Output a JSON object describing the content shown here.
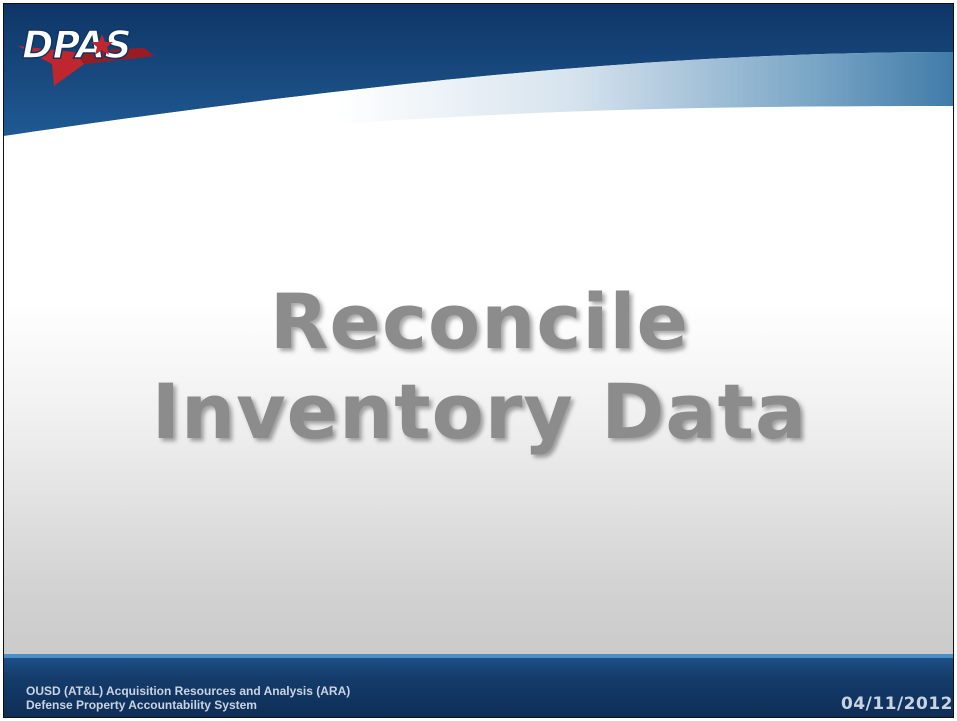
{
  "header": {
    "logo_text": "DPAS"
  },
  "slide": {
    "title_line1": "Reconcile",
    "title_line2": "Inventory Data"
  },
  "footer": {
    "org_line1": "OUSD (AT&L) Acquisition Resources and Analysis (ARA)",
    "org_line2": "Defense Property Accountability System",
    "date": "04/11/2012"
  },
  "colors": {
    "header_blue": "#1b4f87",
    "footer_blue": "#143b6a",
    "title_gray": "#8c8c8c",
    "logo_red": "#c0262d"
  }
}
